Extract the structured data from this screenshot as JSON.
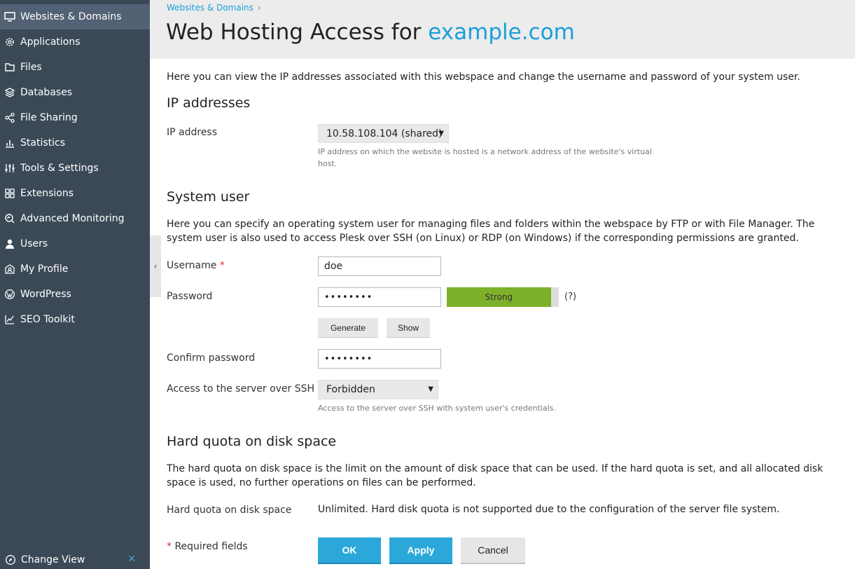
{
  "sidebar": {
    "items": [
      {
        "label": "Websites & Domains",
        "icon": "monitor-icon"
      },
      {
        "label": "Applications",
        "icon": "gear-icon"
      },
      {
        "label": "Files",
        "icon": "folder-icon"
      },
      {
        "label": "Databases",
        "icon": "database-icon"
      },
      {
        "label": "File Sharing",
        "icon": "share-icon"
      },
      {
        "label": "Statistics",
        "icon": "bar-chart-icon"
      },
      {
        "label": "Tools & Settings",
        "icon": "sliders-icon"
      },
      {
        "label": "Extensions",
        "icon": "puzzle-icon"
      },
      {
        "label": "Advanced Monitoring",
        "icon": "monitoring-icon"
      },
      {
        "label": "Users",
        "icon": "user-icon"
      },
      {
        "label": "My Profile",
        "icon": "profile-icon"
      },
      {
        "label": "WordPress",
        "icon": "wordpress-icon"
      },
      {
        "label": "SEO Toolkit",
        "icon": "seo-icon"
      }
    ],
    "change_view": "Change View",
    "close_glyph": "✕"
  },
  "header": {
    "breadcrumb": "Websites & Domains",
    "breadcrumb_sep": "›",
    "title_prefix": "Web Hosting Access for ",
    "title_domain": "example.com"
  },
  "intro": "Here you can view the IP addresses associated with this webspace and change the username and password of your system user.",
  "ip_section": {
    "title": "IP addresses",
    "ip_label": "IP address",
    "ip_value": "10.58.108.104 (shared)",
    "ip_hint": "IP address on which the website is hosted is a network address of the website's virtual host."
  },
  "system_user": {
    "title": "System user",
    "description": "Here you can specify an operating system user for managing files and folders within the webspace by FTP or with File Manager. The system user is also used to access Plesk over SSH (on Linux) or RDP (on Windows) if the corresponding permissions are granted.",
    "username_label": "Username",
    "required_mark": "*",
    "username_value": "doe",
    "password_label": "Password",
    "password_value": "••••••••",
    "strength_label": "Strong",
    "strength_level": 0.93,
    "help_label": "(?)",
    "generate_label": "Generate",
    "show_label": "Show",
    "confirm_label": "Confirm password",
    "confirm_value": "••••••••",
    "ssh_label": "Access to the server over SSH",
    "ssh_value": "Forbidden",
    "ssh_hint": "Access to the server over SSH with system user's credentials."
  },
  "quota": {
    "title": "Hard quota on disk space",
    "description": "The hard quota on disk space is the limit on the amount of disk space that can be used. If the hard quota is set, and all allocated disk space is used, no further operations on files can be performed.",
    "label": "Hard quota on disk space",
    "value": "Unlimited. Hard disk quota is not supported due to the configuration of the server file system."
  },
  "footer": {
    "required_mark": "*",
    "required_text": " Required fields",
    "ok_label": "OK",
    "apply_label": "Apply",
    "cancel_label": "Cancel"
  },
  "colors": {
    "sidebar_bg": "#3b4957",
    "sidebar_active": "#526173",
    "accent": "#1a9fd9",
    "strength_green": "#7eb12a",
    "button_primary": "#2ba8d9"
  }
}
